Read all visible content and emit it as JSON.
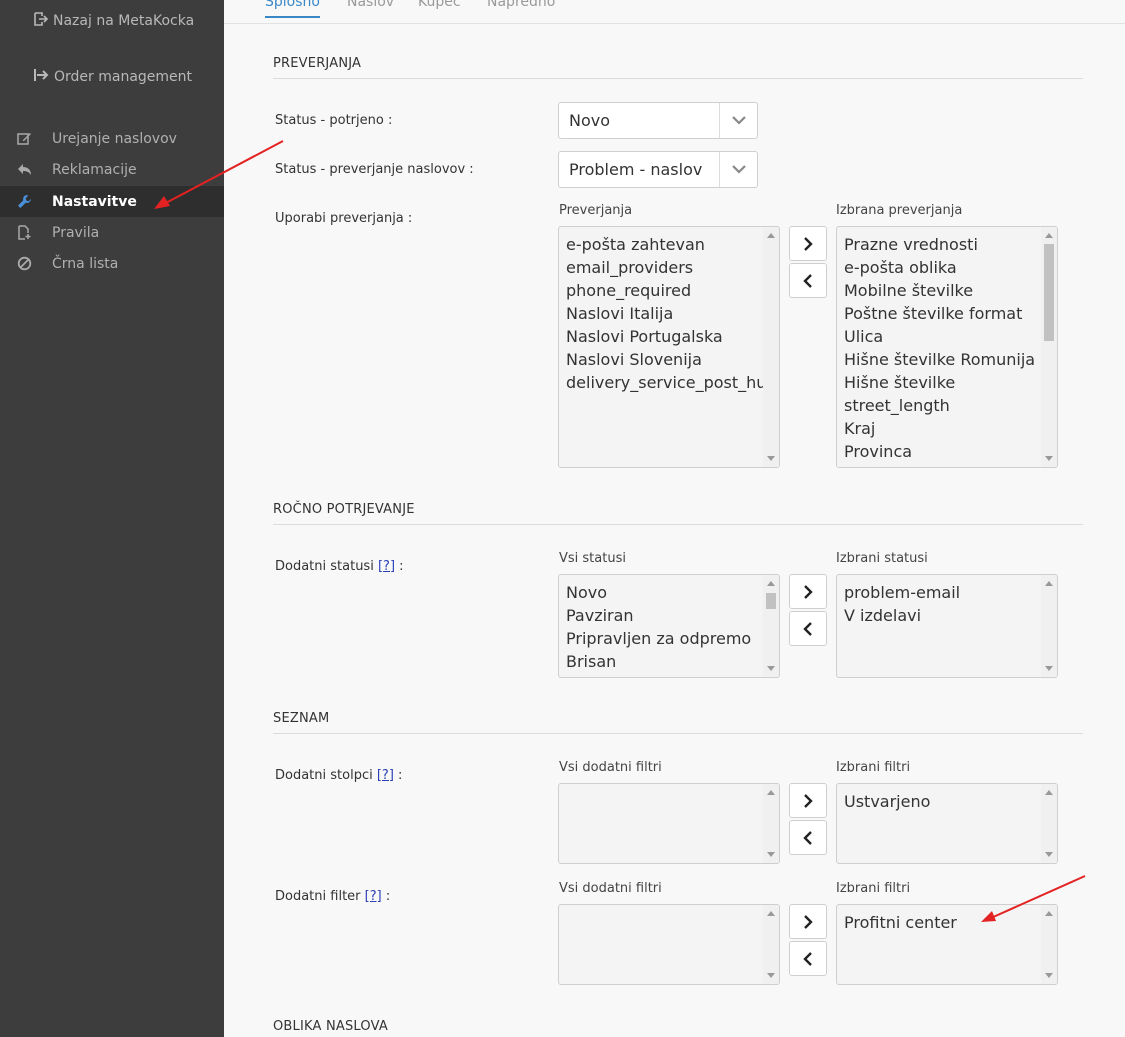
{
  "sidebar": {
    "top_links": [
      {
        "label": "Nazaj na MetaKocka",
        "icon": "sign-out-icon"
      },
      {
        "label": "Order management",
        "icon": "arrow-right-icon"
      }
    ],
    "items": [
      {
        "label": "Urejanje naslovov",
        "icon": "edit-icon"
      },
      {
        "label": "Reklamacije",
        "icon": "reply-icon"
      },
      {
        "label": "Nastavitve",
        "icon": "wrench-icon",
        "active": true
      },
      {
        "label": "Pravila",
        "icon": "file-add-icon"
      },
      {
        "label": "Črna lista",
        "icon": "ban-icon"
      }
    ]
  },
  "tabs": [
    "Splošno",
    "Naslov",
    "Kupec",
    "Napredno"
  ],
  "sections": {
    "preverjanja": {
      "title": "PREVERJANJA",
      "status_potrjeno": {
        "label": "Status - potrjeno :",
        "value": "Novo"
      },
      "status_preverjanje": {
        "label": "Status - preverjanje naslovov :",
        "value": "Problem - naslov"
      },
      "uporabi": {
        "label": "Uporabi preverjanja :",
        "left_title": "Preverjanja",
        "left_items": [
          "e-pošta zahtevan",
          "email_providers",
          "phone_required",
          "Naslovi Italija",
          "Naslovi Portugalska",
          "Naslovi Slovenija",
          "delivery_service_post_hu"
        ],
        "right_title": "Izbrana preverjanja",
        "right_items": [
          "Prazne vrednosti",
          "e-pošta oblika",
          "Mobilne številke",
          "Poštne številke format",
          "Ulica",
          "Hišne številke Romunija",
          "Hišne številke",
          "street_length",
          "Kraj",
          "Provinca"
        ]
      }
    },
    "rocno": {
      "title": "ROČNO POTRJEVANJE",
      "dodatni_statusi": {
        "label": "Dodatni statusi",
        "help": "[?]",
        "colon": ":",
        "left_title": "Vsi statusi",
        "left_items": [
          "Novo",
          "Pavziran",
          "Pripravljen za odpremo",
          "Brisan"
        ],
        "right_title": "Izbrani statusi",
        "right_items": [
          "problem-email",
          "V izdelavi"
        ]
      }
    },
    "seznam": {
      "title": "SEZNAM",
      "dodatni_stolpci": {
        "label": "Dodatni stolpci",
        "help": "[?]",
        "colon": ":",
        "left_title": "Vsi dodatni filtri",
        "left_items": [],
        "right_title": "Izbrani filtri",
        "right_items": [
          "Ustvarjeno"
        ]
      },
      "dodatni_filter": {
        "label": "Dodatni filter",
        "help": "[?]",
        "colon": ":",
        "left_title": "Vsi dodatni filtri",
        "left_items": [],
        "right_title": "Izbrani filtri",
        "right_items": [
          "Profitni center"
        ]
      }
    },
    "oblika": {
      "title": "OBLIKA NASLOVA"
    }
  },
  "colors": {
    "sidebar_bg": "#3d3d3d",
    "active_tab": "#3a87c8",
    "annotation_arrow": "#e32222"
  }
}
